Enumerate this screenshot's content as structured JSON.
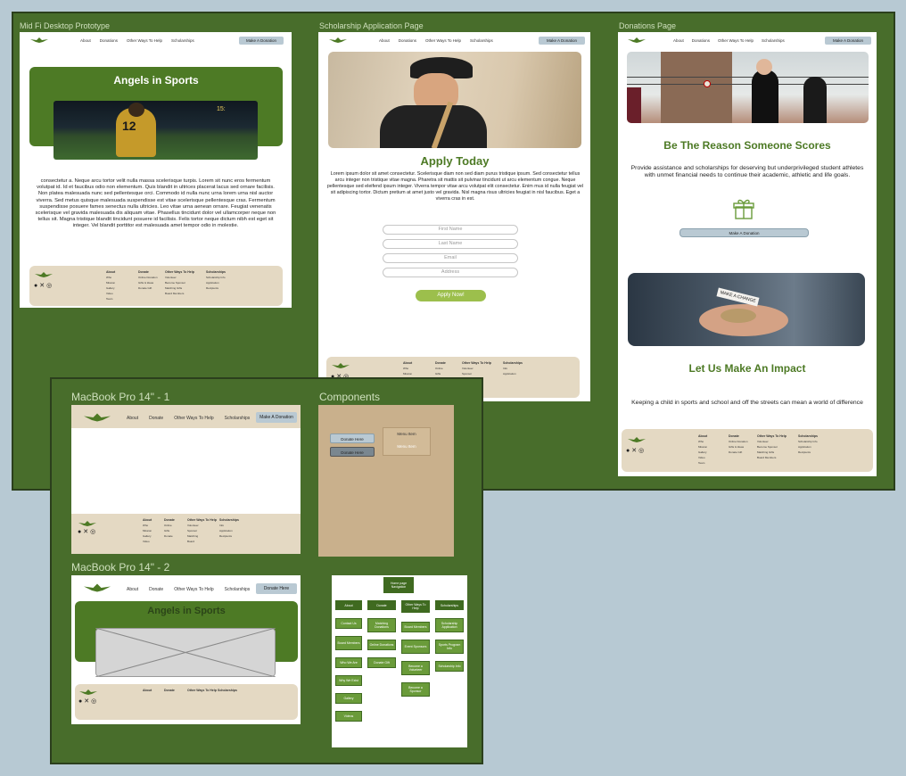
{
  "frames": {
    "midfi": "Mid Fi Desktop Prototype",
    "scholar": "Scholarship Application Page",
    "donations": "Donations Page",
    "mac1": "MacBook Pro 14\" - 1",
    "components": "Components",
    "mac2": "MacBook Pro 14\" - 2"
  },
  "nav": {
    "about": "About",
    "donations": "Donations",
    "other": "Other Ways To Help",
    "scholarships": "Scholarships",
    "cta": "Make A Donation"
  },
  "nav_mac": {
    "about": "About",
    "donate": "Donate",
    "other": "Other Ways To Help",
    "scholarships": "Scholarships",
    "cta1": "Make A Donation",
    "cta2": "Donate Here"
  },
  "midfi": {
    "hero_title": "Angels in Sports",
    "body": "consectetur a. Neque arcu tortor velit nulla massa scelerisque turpis. Lorem sit nunc eros fermentum volutpat id. Id et faucibus odio non elementum. Quis blandit in ultrices placerat lacus sed ornare facilisis. Non platea malesuada nunc sed pellentesque orci. Commodo id nulla nunc urna lorem urna nisl auctor viverra. Sed metus quisque malesuada suspendisse est vitae scelerisque pellentesque cras. Fermentum suspendisse posuere fames senectus nulla ultricies. Leo vitae urna aenean ornare. Feugiat venenatis scelerisque vel gravida malesuada dis aliquam vitae. Phasellus tincidunt dolor vel ullamcorper neque non tellus sit. Magna tristique blandit tincidunt posuere id facilisis. Felis tortor neque dictum nibh est eget sit integer. Vel blandit porttitor est malesuada amet tempor odio in molestie."
  },
  "scholar": {
    "title": "Apply Today",
    "body": "Lorem ipsum dolor sit amet consectetur. Scelerisque diam non sed diam purus tristique ipsum. Sed consectetur tellus arcu integer non tristique vitae magna. Pharetra sit mattis sit pulvinar tincidunt ut arcu elementum congue. Neque pellentesque sed eleifend ipsum integer. Viverra tempor vitae arcu volutpat elit consectetur. Enim mus id nulla feugiat vel sit adipiscing tortor. Dictum pretium at amet justo vel gravida. Nisl magna risus ultricies feugiat in nisl faucibus. Eget a viverra cras in est.",
    "first": "First Name",
    "last": "Last Name",
    "email": "Email",
    "address": "Address",
    "apply": "Apply Now!"
  },
  "donations": {
    "title1": "Be The Reason Someone Scores",
    "body1": "Provide assistance and scholarships for deserving but underprivileged student athletes with unmet financial needs to continue their academic, athletic and life goals.",
    "btn": "Make A Donation",
    "title2": "Let Us Make An Impact",
    "body2": "Keeping a child in sports and school and off the streets can mean a world of difference",
    "sign": "MAKE A CHANGE"
  },
  "footer": {
    "col1": "About",
    "col2": "Donate",
    "col3": "Other Ways To Help",
    "col4": "Scholarships"
  },
  "components": {
    "btn1": "Donate Here",
    "btn2": "Donate Here",
    "menu1": "Menu Item",
    "menu2": "Menu Item"
  },
  "mac2": {
    "title": "Angels in Sports"
  },
  "sitemap": {
    "root": "Home page Navigation",
    "about": "About",
    "donate": "Donate",
    "other": "Other Ways To Help",
    "scholarships": "Scholarships",
    "contact": "Contact Us",
    "matching": "Matching Donations",
    "scholar_app": "Scholarship Application",
    "board": "Board Members",
    "online": "Online Donations",
    "event": "Event Sponsors",
    "board_recipients": "Board Recipients",
    "sports_program": "Sports Program Info",
    "who": "Who We Are",
    "donate_gift": "Donate Gift",
    "become_volunteer": "Become a Volunteer",
    "stories": "Scholarship Info",
    "why": "Why We Exist",
    "become_sponsor": "Become a Sponsor",
    "gallery": "Gallery",
    "videos": "Videos"
  },
  "icons": [
    "shield-logo-icon",
    "facebook-icon",
    "x-icon",
    "instagram-icon",
    "gift-icon"
  ],
  "colors": {
    "board": "#486d2b",
    "accent": "#4d7a25",
    "cta": "#b9c9d3",
    "footer": "#e4d9c3",
    "bg": "#b7c9d3"
  }
}
